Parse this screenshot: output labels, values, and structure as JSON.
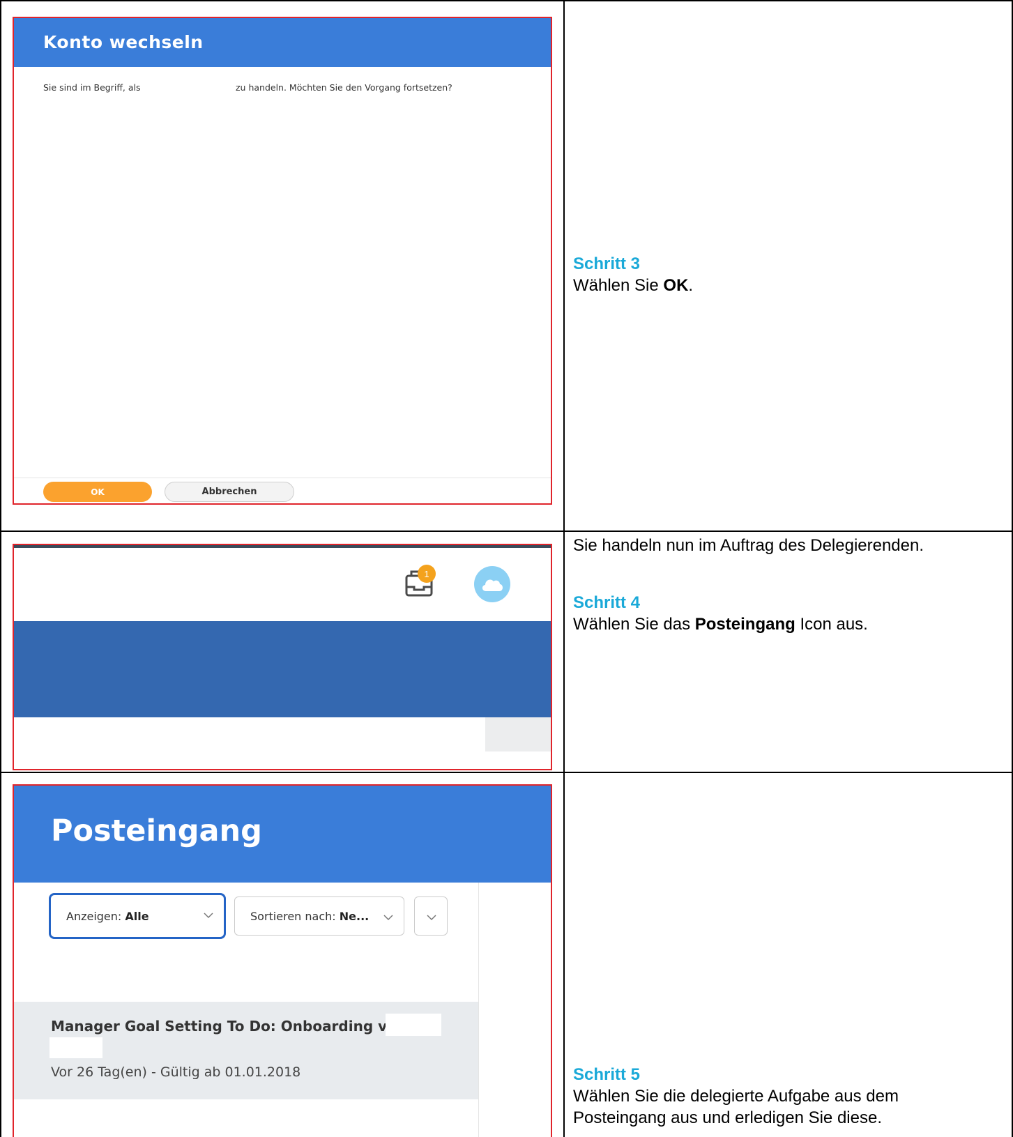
{
  "step3": {
    "dialog_title": "Konto wechseln",
    "message_part1": "Sie sind im Begriff, als",
    "message_part2": "zu handeln. Möchten Sie den Vorgang fortsetzen?",
    "ok_label": "OK",
    "cancel_label": "Abbrechen",
    "heading": "Schritt 3",
    "text_before": "Wählen Sie ",
    "text_bold": "OK",
    "text_after": "."
  },
  "step4": {
    "inbox_badge": "1",
    "intro": "Sie handeln nun im Auftrag des Delegierenden.",
    "heading": "Schritt 4",
    "text_before": "Wählen Sie das ",
    "text_bold": "Posteingang",
    "text_after": " Icon aus."
  },
  "step5": {
    "page_title": "Posteingang",
    "show_label": "Anzeigen: ",
    "show_value": "Alle",
    "sort_label": "Sortieren nach: ",
    "sort_value": "Ne...",
    "task_title": "Manager Goal Setting To Do: Onboarding von",
    "task_meta": "Vor 26 Tag(en) - Gültig ab 01.01.2018",
    "heading": "Schritt 5",
    "text_line1": "Wählen Sie die delegierte Aufgabe aus dem",
    "text_line2": "Posteingang aus und erledigen Sie diese."
  },
  "colors": {
    "header_blue": "#3a7dd9",
    "dark_blue": "#3468b0",
    "ok_orange": "#fba22e",
    "step_heading": "#1aa9d8",
    "highlight_border": "#e0242b"
  }
}
